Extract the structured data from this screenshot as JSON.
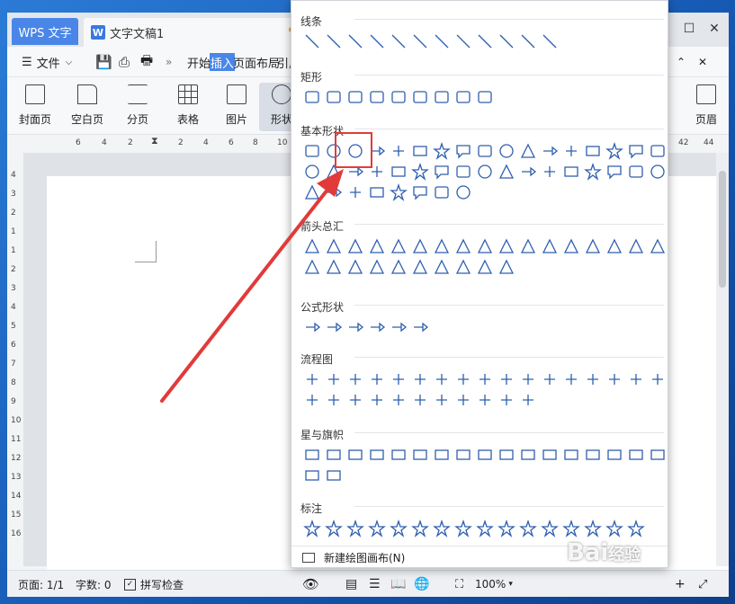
{
  "app": {
    "tab_label": "WPS 文字",
    "doc_tab_label": "文字文稿1",
    "doc_icon_letter": "W"
  },
  "menubar": {
    "file_label": "文件",
    "menus": [
      "开始",
      "插入",
      "页面布局",
      "引用"
    ],
    "active_menu": "插入"
  },
  "ribbon": {
    "buttons": [
      "封面页",
      "空白页",
      "分页",
      "表格",
      "图片",
      "形状"
    ],
    "right_button": "页眉"
  },
  "ruler": {
    "h_ticks": [
      "6",
      "4",
      "2",
      "2",
      "4",
      "6",
      "8",
      "10",
      "42",
      "44"
    ],
    "v_ticks": [
      "4",
      "3",
      "2",
      "1",
      "1",
      "2",
      "3",
      "4",
      "5",
      "6",
      "7",
      "8",
      "9",
      "10",
      "11",
      "12",
      "13",
      "14",
      "15",
      "16"
    ]
  },
  "dropdown": {
    "top_section_partial": "线条",
    "sections": [
      {
        "title": "线条",
        "count": 12
      },
      {
        "title": "矩形",
        "count": 9
      },
      {
        "title": "基本形状",
        "count": 42
      },
      {
        "title": "箭头总汇",
        "count": 27
      },
      {
        "title": "公式形状",
        "count": 6
      },
      {
        "title": "流程图",
        "count": 28
      },
      {
        "title": "星与旗帜",
        "count": 19
      },
      {
        "title": "标注",
        "count": 16
      }
    ],
    "footer_label": "新建绘图画布(N)"
  },
  "status": {
    "page": "页面: 1/1",
    "words": "字数: 0",
    "spell": "拼写检查",
    "zoom": "100%"
  },
  "watermark": "Bai经验",
  "colors": {
    "accent": "#4a86e8",
    "shape_stroke": "#2f5fae",
    "highlight": "#e23a3a"
  }
}
